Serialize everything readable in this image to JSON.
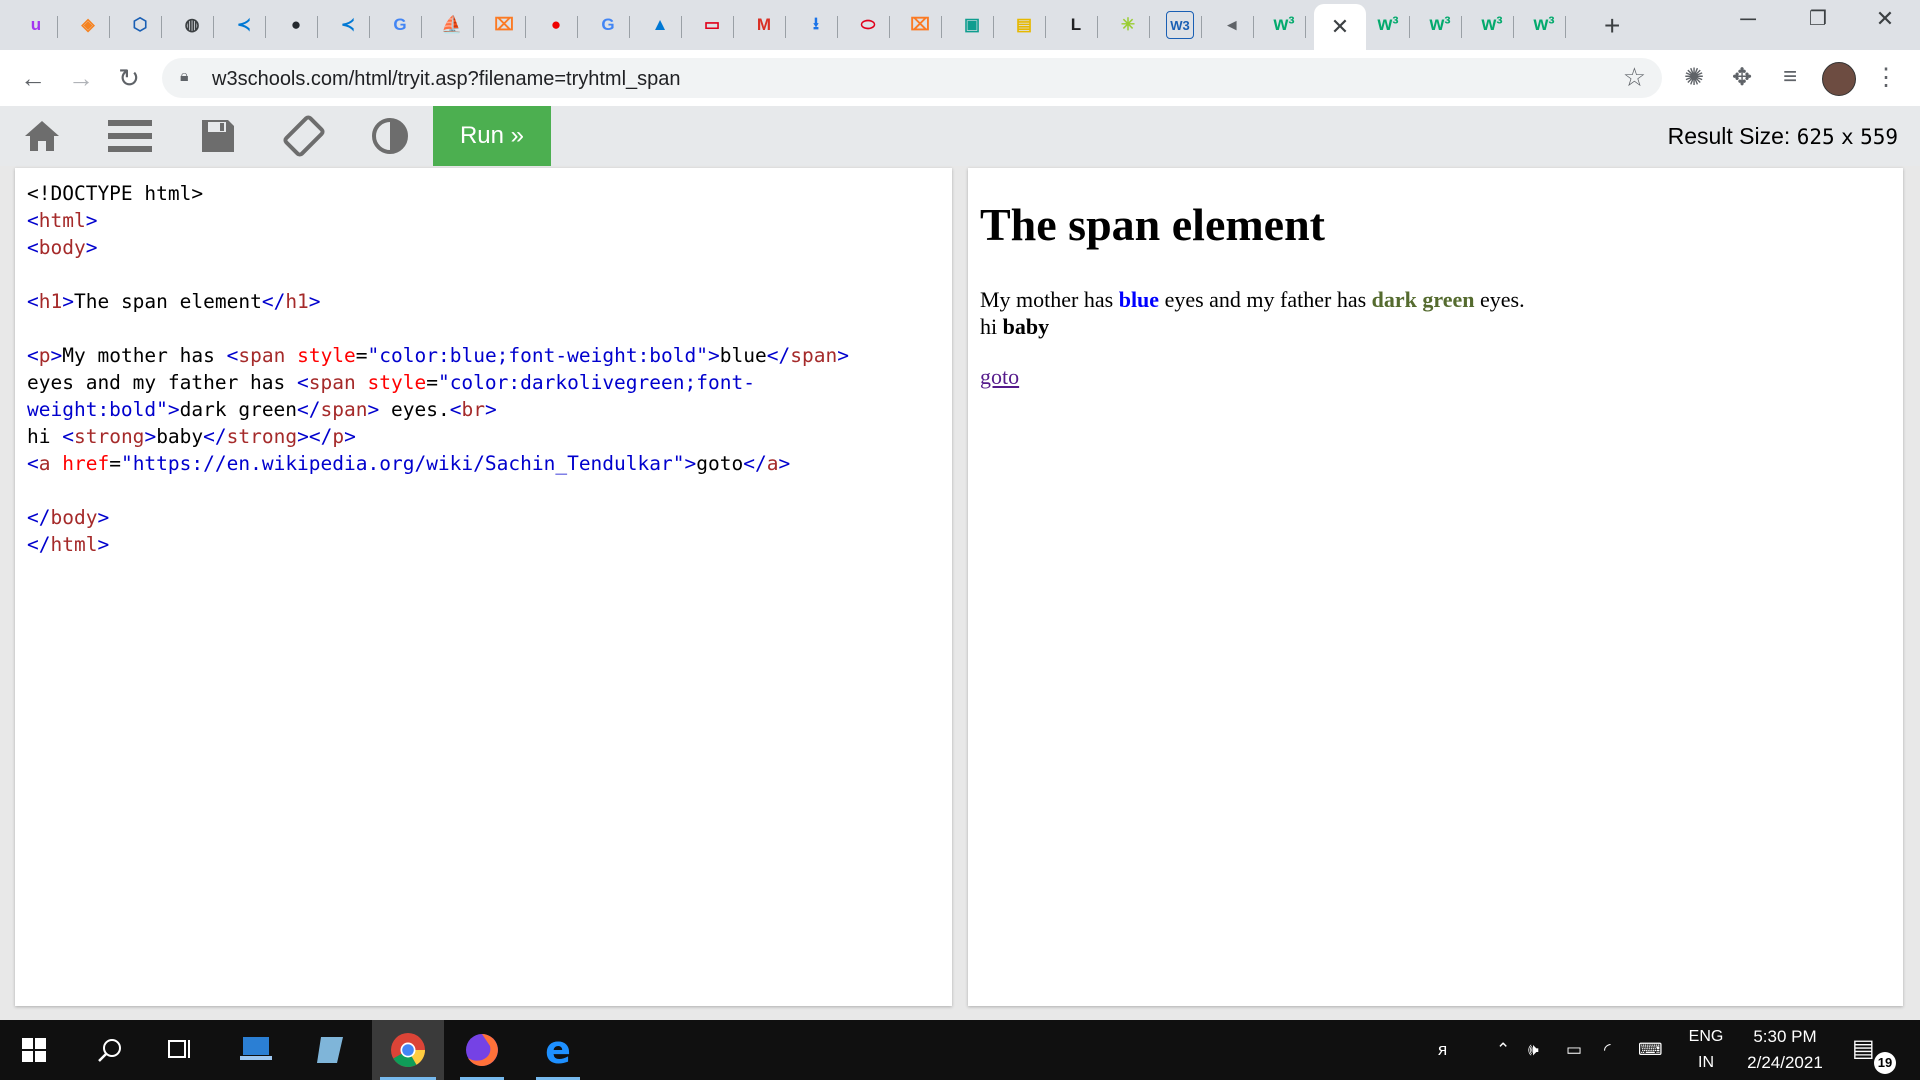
{
  "browser": {
    "tabs": [
      {
        "icon": "udemy-icon",
        "glyph": "u",
        "color": "#a435f0"
      },
      {
        "icon": "diamond-icon",
        "glyph": "◈",
        "color": "#f58220"
      },
      {
        "icon": "hexagon-icon",
        "glyph": "⬡",
        "color": "#1a5fb4"
      },
      {
        "icon": "globe-icon",
        "glyph": "◍",
        "color": "#3c4043"
      },
      {
        "icon": "vscode-icon",
        "glyph": "≺",
        "color": "#0078d4"
      },
      {
        "icon": "github-icon",
        "glyph": "●",
        "color": "#24292e"
      },
      {
        "icon": "vscode-icon",
        "glyph": "≺",
        "color": "#0078d4"
      },
      {
        "icon": "google-icon",
        "glyph": "G",
        "color": "#4285f4"
      },
      {
        "icon": "phpmyadmin-icon",
        "glyph": "⛵",
        "color": "#8a8a8a"
      },
      {
        "icon": "xampp-icon",
        "glyph": "⌧",
        "color": "#fb7a24"
      },
      {
        "icon": "redhat-icon",
        "glyph": "●",
        "color": "#ee0000"
      },
      {
        "icon": "google-icon",
        "glyph": "G",
        "color": "#4285f4"
      },
      {
        "icon": "azure-icon",
        "glyph": "▲",
        "color": "#0078d4"
      },
      {
        "icon": "oracle-icon",
        "glyph": "▭",
        "color": "#e0001b"
      },
      {
        "icon": "gmail-icon",
        "glyph": "M",
        "color": "#d93025"
      },
      {
        "icon": "download-icon",
        "glyph": "⭳",
        "color": "#1a73e8"
      },
      {
        "icon": "oracle-ring-icon",
        "glyph": "⬭",
        "color": "#e0001b"
      },
      {
        "icon": "xampp-icon",
        "glyph": "⌧",
        "color": "#fb7a24"
      },
      {
        "icon": "contact-icon",
        "glyph": "▣",
        "color": "#0f9d8f"
      },
      {
        "icon": "zip-icon",
        "glyph": "▤",
        "color": "#e6b800"
      },
      {
        "icon": "letter-l-icon",
        "glyph": "L",
        "color": "#202124"
      },
      {
        "icon": "puzzle-icon",
        "glyph": "✳",
        "color": "#9acd32"
      },
      {
        "icon": "w3-icon",
        "glyph": "W3",
        "color": "#1a5fb4"
      },
      {
        "icon": "mute-icon",
        "glyph": "◂",
        "color": "#5f6368"
      },
      {
        "icon": "w3schools-icon",
        "glyph": "w³",
        "color": "#04aa6d"
      },
      {
        "icon": "close-icon",
        "glyph": "✕",
        "color": "#3c4043",
        "active": true
      },
      {
        "icon": "w3schools-icon",
        "glyph": "w³",
        "color": "#04aa6d"
      },
      {
        "icon": "w3schools-icon",
        "glyph": "w³",
        "color": "#04aa6d"
      },
      {
        "icon": "w3schools-icon",
        "glyph": "w³",
        "color": "#04aa6d"
      },
      {
        "icon": "w3schools-icon",
        "glyph": "w³",
        "color": "#04aa6d"
      }
    ],
    "url": "w3schools.com/html/tryit.asp?filename=tryhtml_span"
  },
  "toolbar": {
    "run_label": "Run »",
    "result_size_label": "Result Size:",
    "result_width": "625",
    "result_x": "x",
    "result_height": "559"
  },
  "result": {
    "heading": "The span element",
    "p_text1": "My mother has ",
    "p_blue": "blue",
    "p_text2": " eyes and my father has ",
    "p_green": "dark green",
    "p_text3": " eyes.",
    "p_hi": "hi ",
    "p_baby": "baby",
    "link": "goto"
  },
  "taskbar": {
    "lang_top": "ENG",
    "lang_bottom": "IN",
    "time": "5:30 PM",
    "date": "2/24/2021",
    "notifications": "19"
  },
  "colors": {
    "run_green": "#4caf50",
    "blue": "#0000ff",
    "darkolivegreen": "#556b2f"
  }
}
